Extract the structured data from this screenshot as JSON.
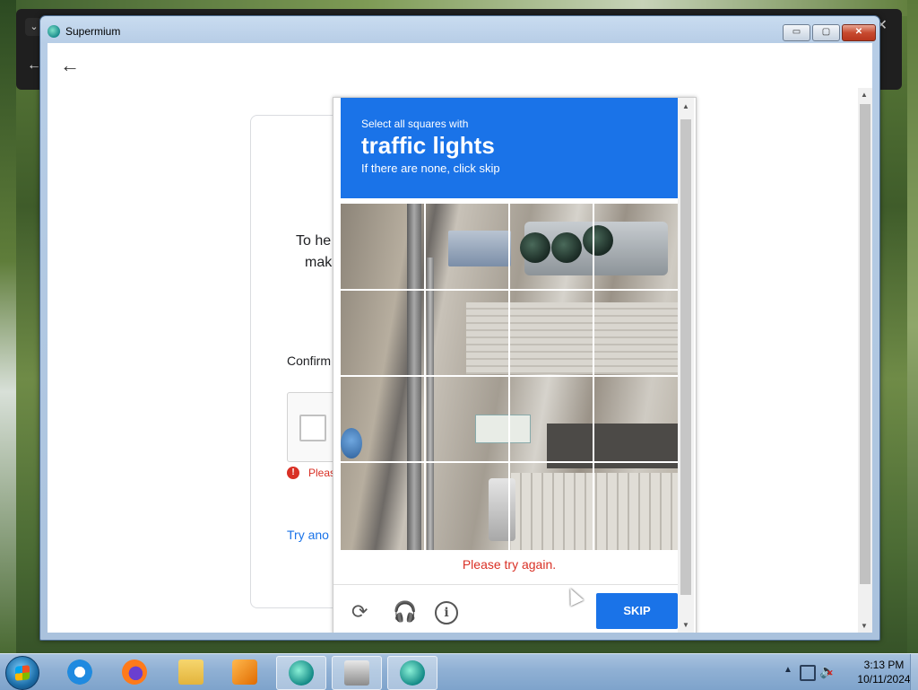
{
  "window": {
    "title": "Supermium",
    "controls": {
      "minimize": "▭",
      "maximize": "▢",
      "close": "✕"
    }
  },
  "page": {
    "back_icon": "arrow-left-icon",
    "card": {
      "help_line1": "To he",
      "help_line2": "mak",
      "confirm_label": "Confirm",
      "error_text": "Pleas",
      "try_link": "Try ano"
    }
  },
  "captcha": {
    "instruction_small": "Select all squares with",
    "instruction_big": "traffic lights",
    "instruction_sub": "If there are none, click skip",
    "grid": {
      "rows": 4,
      "cols": 4
    },
    "error_message": "Please try again.",
    "skip_label": "SKIP",
    "icons": [
      "reload-icon",
      "audio-icon",
      "info-icon"
    ],
    "accent_color": "#1a73e8"
  },
  "taskbar": {
    "pinned": [
      "internet-explorer-icon",
      "firefox-icon",
      "file-explorer-icon",
      "media-player-icon",
      "supermium-icon",
      "screen-capture-icon",
      "supermium-icon"
    ],
    "clock_time": "3:13 PM",
    "clock_date": "10/11/2024"
  }
}
